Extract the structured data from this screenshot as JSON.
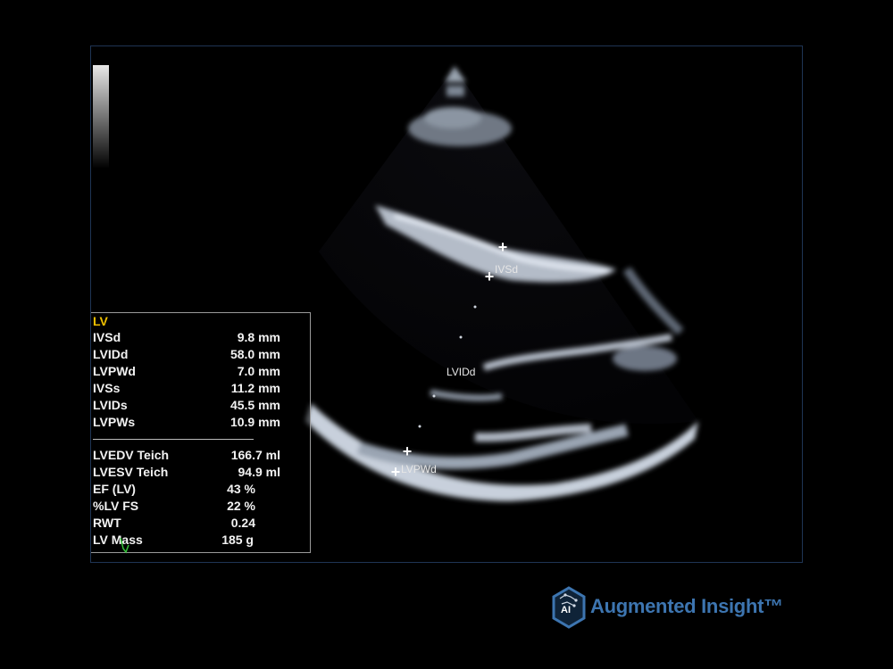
{
  "echo": {
    "labels": {
      "ivsd": "IVSd",
      "lvidd": "LVIDd",
      "lvpwd": "LVPWd"
    }
  },
  "measurements": {
    "title": "LV",
    "rows": [
      {
        "name": "IVSd",
        "value": "9.8 mm"
      },
      {
        "name": "LVIDd",
        "value": "58.0 mm"
      },
      {
        "name": "LVPWd",
        "value": "7.0 mm"
      },
      {
        "name": "IVSs",
        "value": "11.2 mm"
      },
      {
        "name": "LVIDs",
        "value": "45.5 mm"
      },
      {
        "name": "LVPWs",
        "value": "10.9 mm"
      },
      {
        "name": "LVEDV Teich",
        "value": "166.7 ml"
      },
      {
        "name": "LVESV Teich",
        "value": "94.9 ml"
      },
      {
        "name": "EF (LV)",
        "value": "43 %"
      },
      {
        "name": "%LV FS",
        "value": "22 %"
      },
      {
        "name": "RWT",
        "value": "0.24"
      },
      {
        "name": "LV Mass",
        "value": "185 g"
      }
    ]
  },
  "brand": {
    "logo_text": "AI",
    "name": "Augmented Insight™",
    "color": "#3d75b0"
  },
  "colors": {
    "panel_title": "#f0c000",
    "viewport_border": "#1f3554"
  }
}
